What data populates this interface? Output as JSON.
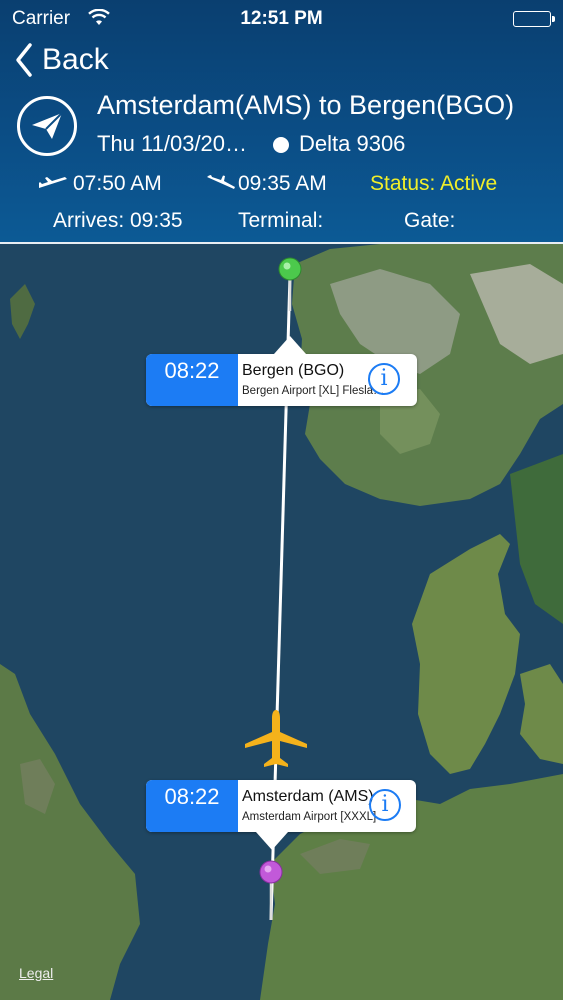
{
  "statusbar": {
    "carrier": "Carrier",
    "time": "12:51 PM"
  },
  "nav": {
    "back_label": "Back"
  },
  "flight": {
    "route": "Amsterdam(AMS) to Bergen(BGO)",
    "date": "Thu 11/03/20…",
    "flight_number": "Delta 9306",
    "departure_time": "07:50 AM",
    "arrival_time": "09:35 AM",
    "status": "Status: Active",
    "arrives": "Arrives: 09:35",
    "terminal": "Terminal:",
    "gate": "Gate:"
  },
  "map": {
    "destination": {
      "time": "08:22",
      "name": "Bergen (BGO)",
      "airport": "Bergen Airport [XL] Flesla…"
    },
    "origin": {
      "time": "08:22",
      "name": "Amsterdam (AMS)",
      "airport": "Amsterdam Airport [XXXL]"
    },
    "legal": "Legal"
  },
  "colors": {
    "accent": "#1c7cf4",
    "status": "#f1ef2a",
    "header": "#0b4d85",
    "plane": "#f5b21b",
    "origin_pin": "#c259d9",
    "dest_pin": "#4cc94c"
  }
}
